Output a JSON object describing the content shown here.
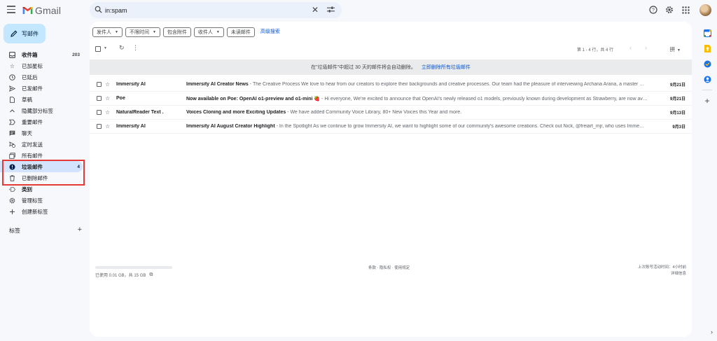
{
  "app": {
    "name": "Gmail"
  },
  "search": {
    "value": "in:spam"
  },
  "compose": {
    "label": "写邮件"
  },
  "sidebar": {
    "items": [
      {
        "label": "收件箱",
        "count": "203",
        "icon": "inbox-icon",
        "bold": true
      },
      {
        "label": "已加星标",
        "count": "",
        "icon": "star-icon"
      },
      {
        "label": "已延后",
        "count": "",
        "icon": "clock-icon"
      },
      {
        "label": "已发邮件",
        "count": "",
        "icon": "send-icon"
      },
      {
        "label": "草稿",
        "count": "",
        "icon": "draft-icon"
      },
      {
        "label": "隐藏部分标签",
        "count": "",
        "icon": "chevron-up-icon"
      },
      {
        "label": "重要邮件",
        "count": "",
        "icon": "important-icon"
      },
      {
        "label": "聊天",
        "count": "",
        "icon": "chat-icon"
      },
      {
        "label": "定时发送",
        "count": "",
        "icon": "scheduled-icon"
      },
      {
        "label": "所有邮件",
        "count": "",
        "icon": "all-mail-icon"
      },
      {
        "label": "垃圾邮件",
        "count": "4",
        "icon": "spam-icon",
        "bold": true,
        "active": true
      },
      {
        "label": "已删除邮件",
        "count": "",
        "icon": "trash-icon"
      },
      {
        "label": "类别",
        "count": "",
        "icon": "category-icon",
        "bold": true
      },
      {
        "label": "管理标签",
        "count": "",
        "icon": "gear-icon"
      },
      {
        "label": "创建新标签",
        "count": "",
        "icon": "plus-icon"
      }
    ],
    "labels_heading": "标签"
  },
  "filters": {
    "chips": [
      "发件人",
      "不限时间",
      "包含附件",
      "收件人",
      "未读邮件"
    ],
    "advanced_search": "高级搜索"
  },
  "toolbar": {
    "pager": "第 1 - 4 行，共 4 行",
    "sort": "拼"
  },
  "banner": {
    "text": "在\"垃圾邮件\"中超过 30 天的邮件将会自动删除。",
    "link": "立即删除所有垃圾邮件"
  },
  "emails": [
    {
      "sender": "Immersity AI",
      "subject": "Immersity AI Creator News",
      "snippet": " - The Creative Process We love to hear from our creators to explore their backgrounds and creative processes. Our team had the pleasure of interviewing Archana Arana, a master …",
      "date": "9月21日"
    },
    {
      "sender": "Poe",
      "subject": "Now available on Poe: OpenAI o1-preview and o1-mini 🍓",
      "snippet": " - Hi everyone, We're excited to announce that OpenAI's newly released o1 models, previously known during development as Strawberry, are now av…",
      "date": "9月21日"
    },
    {
      "sender": "NaturalReader Text .",
      "subject": "Voices Cloning and more Exciting Updates",
      "snippet": " - We have added Community Voice Library, 80+ New Voices this Year and more.",
      "date": "9月13日"
    },
    {
      "sender": "Immersity AI",
      "subject": "Immersity AI August Creator Highlight",
      "snippet": " - In the Spotlight As we continue to grow Immersity AI, we want to highlight some of our community's awesome creations. Check out Nick, @freiart_mjr, who uses Imme…",
      "date": "9月3日"
    }
  ],
  "footer": {
    "storage": "已使用 0.01 GB，共 15 GB",
    "storage_used_fraction": 0.001,
    "links": "条款 · 隐私权 · 使用规定",
    "last_activity": "上次账号活动时间：4小时前",
    "details": "详细信息"
  },
  "colors": {
    "accent": "#0b57d0",
    "compose_bg": "#c2e7ff",
    "active_nav": "#d3e3fd",
    "highlight": "#e53935"
  }
}
